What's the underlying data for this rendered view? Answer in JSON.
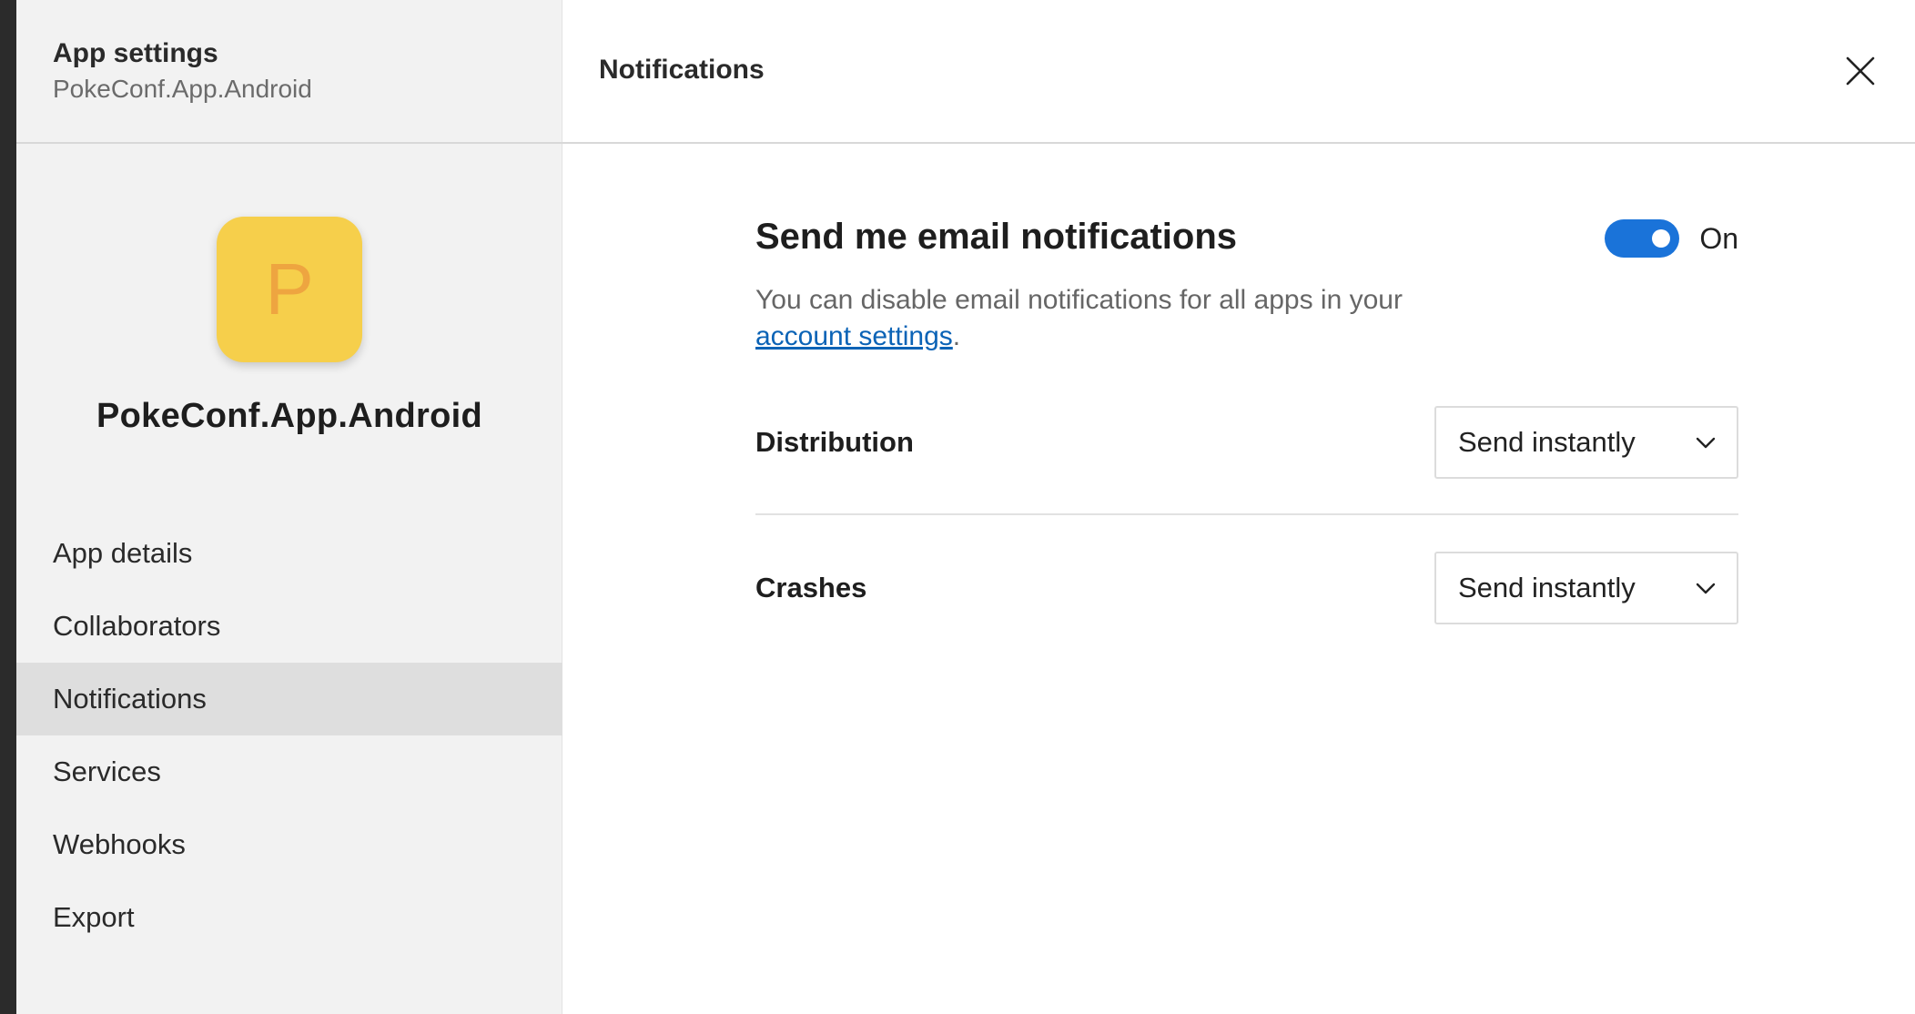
{
  "sidebar": {
    "title": "App settings",
    "subtitle": "PokeConf.App.Android",
    "app_icon_letter": "P",
    "app_name": "PokeConf.App.Android",
    "nav_items": [
      {
        "label": "App details",
        "active": false
      },
      {
        "label": "Collaborators",
        "active": false
      },
      {
        "label": "Notifications",
        "active": true
      },
      {
        "label": "Services",
        "active": false
      },
      {
        "label": "Webhooks",
        "active": false
      },
      {
        "label": "Export",
        "active": false
      }
    ]
  },
  "header": {
    "title": "Notifications",
    "close_icon": "close-icon"
  },
  "email": {
    "title": "Send me email notifications",
    "toggle_state": "On",
    "description": "You can disable email notifications for all apps in your",
    "link_text": "account settings",
    "suffix": "."
  },
  "settings": [
    {
      "label": "Distribution",
      "value": "Send instantly"
    },
    {
      "label": "Crashes",
      "value": "Send instantly"
    }
  ],
  "colors": {
    "accent": "#1a73d9",
    "link": "#0b63b6",
    "app_icon_bg": "#f6cf4b",
    "app_icon_letter": "#eea540",
    "sidebar_bg": "#f2f2f2",
    "active_nav_bg": "#dedede"
  }
}
